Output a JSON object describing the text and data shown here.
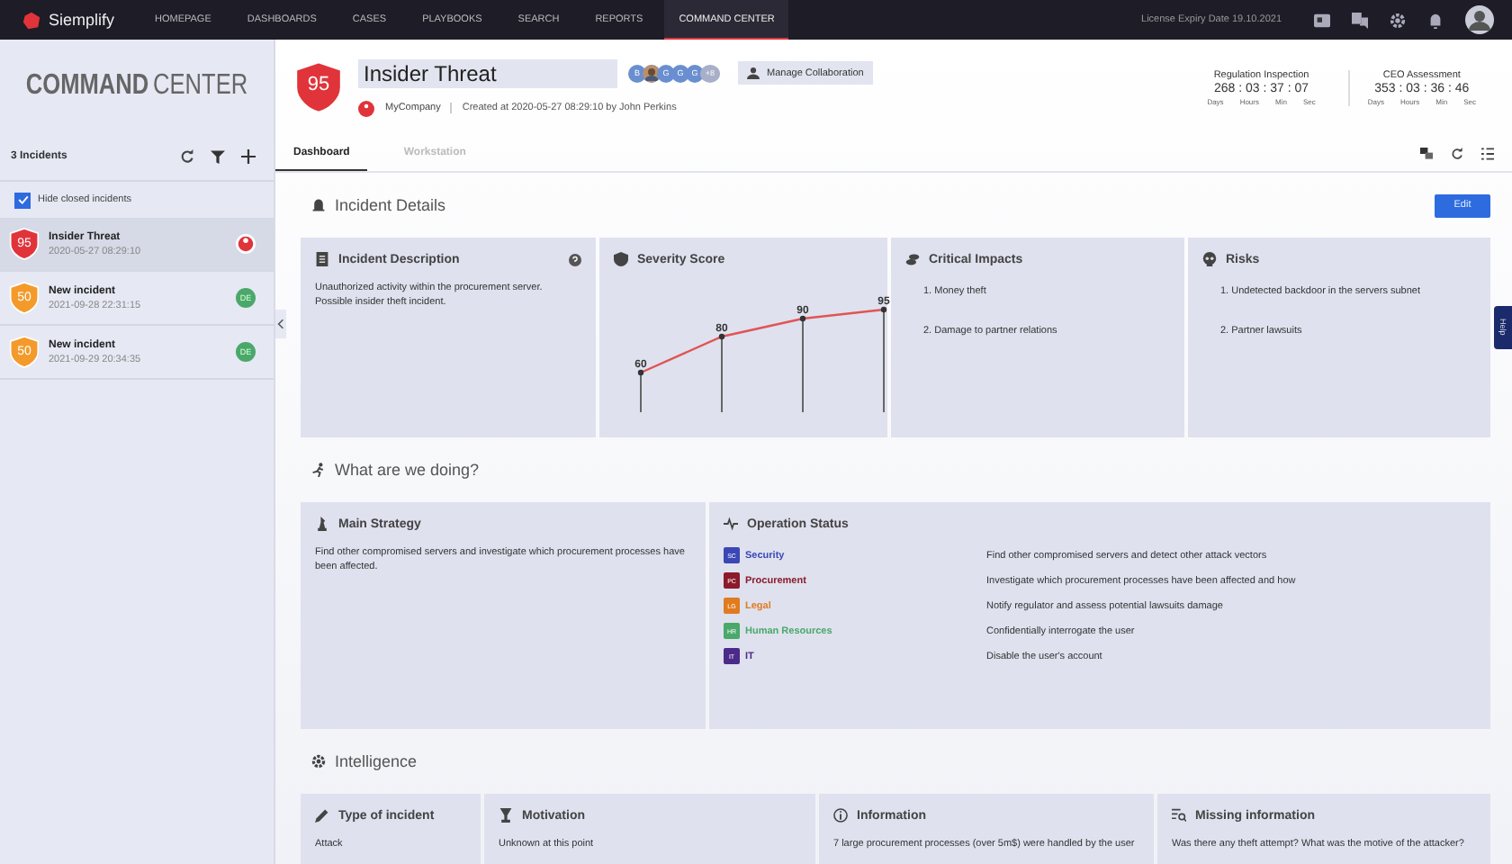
{
  "nav": {
    "brand": "Siemplify",
    "items": [
      {
        "label": "HOMEPAGE",
        "selected": false
      },
      {
        "label": "DASHBOARDS",
        "selected": false
      },
      {
        "label": "CASES",
        "selected": false
      },
      {
        "label": "PLAYBOOKS",
        "selected": false
      },
      {
        "label": "SEARCH",
        "selected": false
      },
      {
        "label": "REPORTS",
        "selected": false
      },
      {
        "label": "COMMAND CENTER",
        "selected": true
      }
    ],
    "license": "License Expiry Date 19.10.2021"
  },
  "sidebar": {
    "logo_bold": "COMMAND",
    "logo_light": "CENTER",
    "count": "3 Incidents",
    "hide_closed": {
      "label": "Hide closed incidents",
      "checked": true
    },
    "incidents": [
      {
        "score": "95",
        "color": "#e0343a",
        "title": "Insider Threat",
        "date": "2020-05-27 08:29:10",
        "selected": true,
        "kind": "flag"
      },
      {
        "score": "50",
        "color": "#f39a2b",
        "title": "New incident",
        "date": "2021-09-28 22:31:15",
        "selected": false,
        "kind": "initials",
        "initials": "DE"
      },
      {
        "score": "50",
        "color": "#f39a2b",
        "title": "New incident",
        "date": "2021-09-29 20:34:35",
        "selected": false,
        "kind": "initials",
        "initials": "DE"
      }
    ]
  },
  "incident": {
    "score": "95",
    "title": "Insider Threat",
    "collaborators": [
      {
        "kind": "initial",
        "text": "B"
      },
      {
        "kind": "photo"
      },
      {
        "kind": "initial",
        "text": "G"
      },
      {
        "kind": "initial",
        "text": "G"
      },
      {
        "kind": "initial",
        "text": "G"
      },
      {
        "kind": "more",
        "text": "+8"
      }
    ],
    "collab_button": "Manage Collaboration",
    "company": "MyCompany",
    "created": "Created at 2020-05-27 08:29:10 by John Perkins",
    "timers": [
      {
        "name": "Regulation Inspection",
        "value": "268 : 03 : 37 : 07",
        "units": [
          "Days",
          "Hours",
          "Min",
          "Sec"
        ]
      },
      {
        "name": "CEO Assessment",
        "value": "353 : 03 : 36 : 46",
        "units": [
          "Days",
          "Hours",
          "Min",
          "Sec"
        ]
      }
    ]
  },
  "tabs": [
    {
      "label": "Dashboard",
      "selected": true
    },
    {
      "label": "Workstation",
      "selected": false
    }
  ],
  "details": {
    "title": "Incident Details",
    "edit": "Edit",
    "description": {
      "title": "Incident Description",
      "text": "Unauthorized activity within the procurement server. Possible insider theft incident."
    },
    "severity": {
      "title": "Severity Score",
      "chart_data": {
        "type": "line",
        "data_labels": true,
        "marker": true,
        "grid": true,
        "series": [
          {
            "color": "#e05555",
            "values": [
              60,
              80,
              90,
              95
            ]
          }
        ]
      }
    },
    "impacts": {
      "title": "Critical Impacts",
      "items": [
        "1. Money theft",
        "2. Damage to partner relations"
      ]
    },
    "risks": {
      "title": "Risks",
      "items": [
        "1. Undetected backdoor in the servers subnet",
        "2. Partner lawsuits"
      ]
    }
  },
  "doing": {
    "title": "What are we doing?",
    "strategy": {
      "title": "Main Strategy",
      "text": "Find other compromised servers and investigate which procurement processes have been affected."
    },
    "operations": {
      "title": "Operation Status",
      "rows": [
        {
          "code": "SC",
          "team": "Security",
          "color": "#3a47b5",
          "task": "Find other compromised servers and detect other attack vectors"
        },
        {
          "code": "PC",
          "team": "Procurement",
          "color": "#8b1a2b",
          "task": "Investigate which procurement processes have been affected and how"
        },
        {
          "code": "LG",
          "team": "Legal",
          "color": "#e07b20",
          "task": "Notify regulator and assess potential lawsuits damage"
        },
        {
          "code": "HR",
          "team": "Human Resources",
          "color": "#4aa86a",
          "task": "Confidentially interrogate the user"
        },
        {
          "code": "IT",
          "team": "IT",
          "color": "#4b2a8a",
          "task": "Disable the user's account"
        }
      ]
    }
  },
  "intelligence": {
    "title": "Intelligence",
    "cards": [
      {
        "title": "Type of incident",
        "text": "Attack"
      },
      {
        "title": "Motivation",
        "text": "Unknown at this point"
      },
      {
        "title": "Information",
        "text": "7 large procurement processes (over 5m$) were handled by the user"
      },
      {
        "title": "Missing information",
        "text": "Was there any theft attempt? What was the motive of the attacker?"
      }
    ]
  },
  "help": "Help"
}
